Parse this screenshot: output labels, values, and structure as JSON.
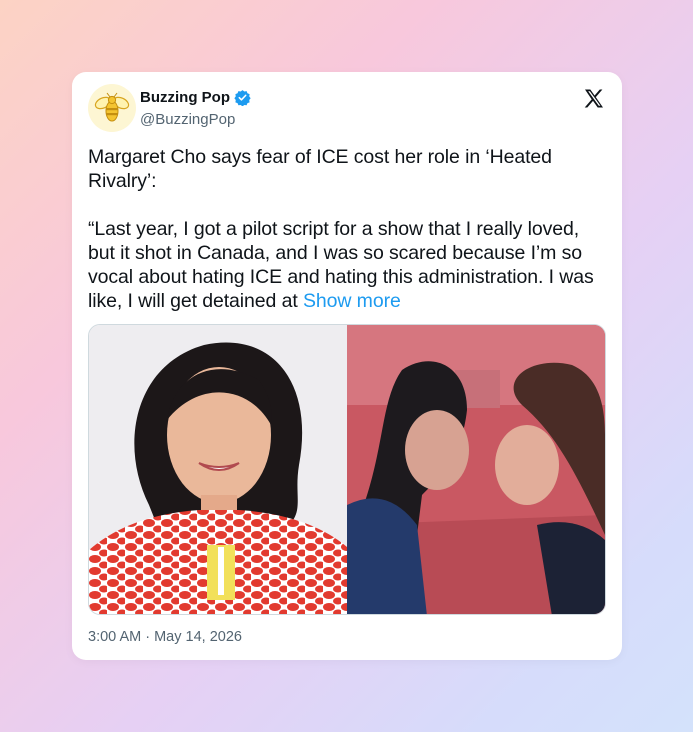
{
  "tweet": {
    "display_name": "Buzzing Pop",
    "handle": "@BuzzingPop",
    "verified": true,
    "text_line1": "Margaret Cho says fear of ICE cost her role in ‘Heated Rivalry’:",
    "text_quote": "“Last year, I got a pilot script for a show that I really loved, but it shot in Canada, and I was so scared because I’m so vocal about hating ICE and hating this administration. I was like, I will get detained at",
    "show_more": "Show more",
    "time": "3:00 AM",
    "separator": " · ",
    "date": "May 14, 2026"
  },
  "icons": {
    "avatar": "bee-logo-icon",
    "verified": "verified-badge-icon",
    "platform": "x-logo-icon"
  },
  "colors": {
    "link": "#1d9bf0",
    "verified": "#1d9bf0",
    "text": "#0f1419",
    "muted": "#536471"
  }
}
